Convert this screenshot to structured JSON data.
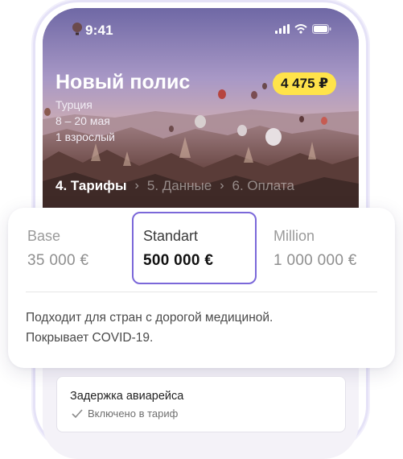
{
  "status_bar": {
    "time": "9:41"
  },
  "policy": {
    "title": "Новый полис",
    "price": "4 475 ₽",
    "country": "Турция",
    "dates": "8 – 20 мая",
    "travelers": "1 взрослый"
  },
  "steps": [
    {
      "label": "4. Тарифы"
    },
    {
      "label": "5. Данные"
    },
    {
      "label": "6. Оплата"
    }
  ],
  "plans": [
    {
      "name": "Base",
      "sum": "35 000 €",
      "selected": false
    },
    {
      "name": "Standart",
      "sum": "500 000 €",
      "selected": true
    },
    {
      "name": "Million",
      "sum": "1 000 000 €",
      "selected": false
    }
  ],
  "plan_description": {
    "line1": "Подходит для стран с дорогой медициной.",
    "line2": "Покрывает COVID-19."
  },
  "option": {
    "title": "Задержка авиарейса",
    "status": "Включено в тариф"
  },
  "colors": {
    "accent": "#7b68d9",
    "price_badge": "#ffe34a"
  }
}
